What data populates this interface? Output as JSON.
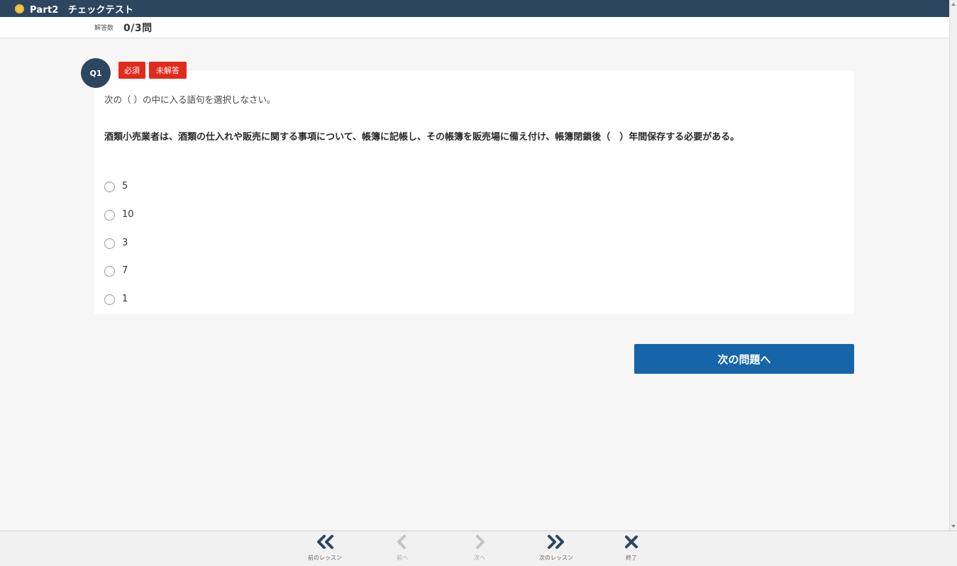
{
  "header": {
    "title": "Part2　チェックテスト"
  },
  "progress": {
    "label": "解答数",
    "count": "0/3問"
  },
  "question": {
    "number": "Q1",
    "tags": [
      "必須",
      "未解答"
    ],
    "instruction": "次の（ ）の中に入る語句を選択しなさい。",
    "text": "酒類小売業者は、酒類の仕入れや販売に関する事項について、帳簿に記帳し、その帳簿を販売場に備え付け、帳簿閉鎖後（　）年間保存する必要がある。",
    "options": [
      "5",
      "10",
      "3",
      "7",
      "1"
    ]
  },
  "next_button": "次の問題へ",
  "footer": {
    "prev_lesson": "前のレッスン",
    "prev": "前へ",
    "next": "次へ",
    "next_lesson": "次のレッスン",
    "exit": "終了"
  },
  "colors": {
    "header_bg": "#2c4660",
    "tag_red": "#e12a1c",
    "button_blue": "#1565a8"
  },
  "icons": {
    "prev_lesson": "double-chevron-left-icon",
    "prev": "chevron-left-icon",
    "next": "chevron-right-icon",
    "next_lesson": "double-chevron-right-icon",
    "exit": "close-icon"
  }
}
